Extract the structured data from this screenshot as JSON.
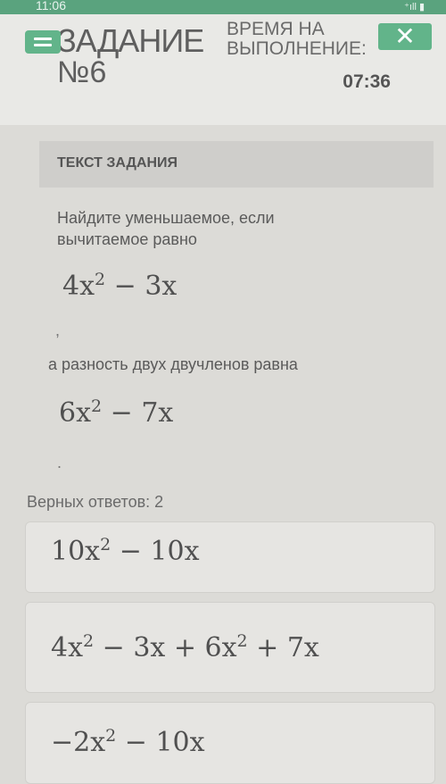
{
  "status_bar": {
    "time": "11:06",
    "signal": "⁺ıll ▮"
  },
  "header": {
    "title_line1": "ЗАДАНИЕ",
    "title_line2": "№6",
    "time_label_line1": "ВРЕМЯ НА",
    "time_label_line2": "ВЫПОЛНЕНИЕ:",
    "timer": "07:36",
    "close_symbol": "✕"
  },
  "task": {
    "section_label": "ТЕКСТ ЗАДАНИЯ",
    "line1": "Найдите уменьшаемое, если",
    "line2": "вычитаемое равно",
    "expr1": {
      "a": "4x",
      "exp": "2",
      "b": " − 3x"
    },
    "comma": ",",
    "line3": "а разность двух двучленов равна",
    "expr2": {
      "a": "6x",
      "exp": "2",
      "b": " − 7x"
    },
    "period": "."
  },
  "answers_label": "Верных ответов: 2",
  "answers": [
    {
      "a": "10x",
      "exp": "2",
      "b": " − 10x"
    },
    {
      "a": "4x",
      "exp": "2",
      "b": " − 3x + 6x",
      "exp2": "2",
      "c": " + 7x"
    },
    {
      "a": "−2x",
      "exp": "2",
      "b": " − 10x"
    }
  ]
}
